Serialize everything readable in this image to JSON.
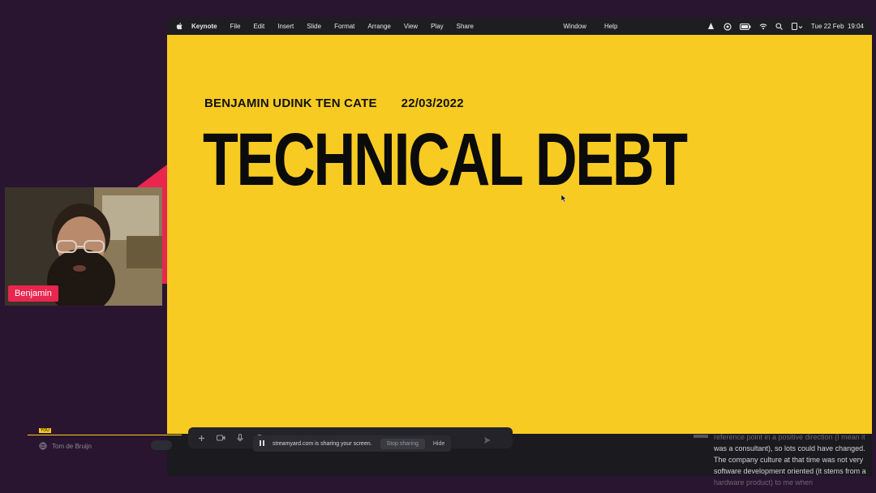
{
  "menubar": {
    "app_name": "Keynote",
    "items": [
      "File",
      "Edit",
      "Insert",
      "Slide",
      "Format",
      "Arrange",
      "View",
      "Play",
      "Share"
    ],
    "window_label": "Window",
    "help_label": "Help",
    "datetime": "Tue 22 Feb  19:04"
  },
  "slide": {
    "author": "BENJAMIN UDINK TEN CATE",
    "date": "22/03/2022",
    "title": "TECHNICAL DEBT",
    "background_color": "#f8cb23"
  },
  "webcam": {
    "participant_name": "Benjamin"
  },
  "streamyard": {
    "badge": "YOU",
    "guest_name": "Tom de Bruijn",
    "share_message": "streamyard.com is sharing your screen.",
    "stop_sharing_label": "Stop sharing",
    "hide_label": "Hide"
  },
  "chat": {
    "line_faded": "reference point in a positive direction (I mean it",
    "lines": [
      "was a consultant), so lots could have changed.",
      "The company culture at that time was not very",
      "software development oriented (it stems from a",
      "hardware product) to me when"
    ]
  },
  "colors": {
    "accent": "#e8264e",
    "background": "#2a1530"
  }
}
